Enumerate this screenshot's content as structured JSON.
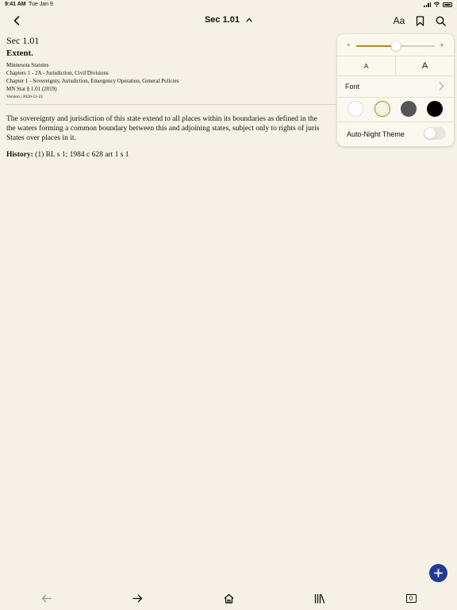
{
  "status": {
    "time": "9:41 AM",
    "date": "Tue Jan 9"
  },
  "nav": {
    "title": "Sec 1.01",
    "font_button": "Aa"
  },
  "document": {
    "section": "Sec 1.01",
    "heading": "Extent.",
    "statute": "Minnesota Statutes",
    "chapters": "Chapters 1 - 2A - Jurisdiction, Civil Divisions",
    "chapter": "Chapter 1 - Sovereignty, Jurisdiction, Emergency Operation, General Policies",
    "citation": "MN Stat § 1.01 (2019)",
    "version": "Version | 2020-11-21",
    "body": "The sovereignty and jurisdiction of this state extend to all places within its boundaries as defined in the\nthe waters forming a common boundary between this and adjoining states, subject only to rights of juris\nStates over places in it.",
    "history_label": "History:",
    "history_text": " (1) RL s 1; 1984 c 628 art 1 s 1"
  },
  "settings": {
    "brightness": 0.5,
    "text_size_small": "A",
    "text_size_large": "A",
    "font_label": "Font",
    "themes": [
      {
        "name": "white",
        "color": "#ffffff",
        "selected": false
      },
      {
        "name": "sepia",
        "color": "#f6f1e6",
        "selected": true
      },
      {
        "name": "gray",
        "color": "#555555",
        "selected": false
      },
      {
        "name": "black",
        "color": "#000000",
        "selected": false
      }
    ],
    "auto_night_label": "Auto-Night Theme",
    "auto_night_on": false
  },
  "toolbar": {
    "tab_count": "0"
  },
  "colors": {
    "background": "#f6f1e6",
    "accent": "#b58a1e",
    "fab": "#1f3b93"
  }
}
